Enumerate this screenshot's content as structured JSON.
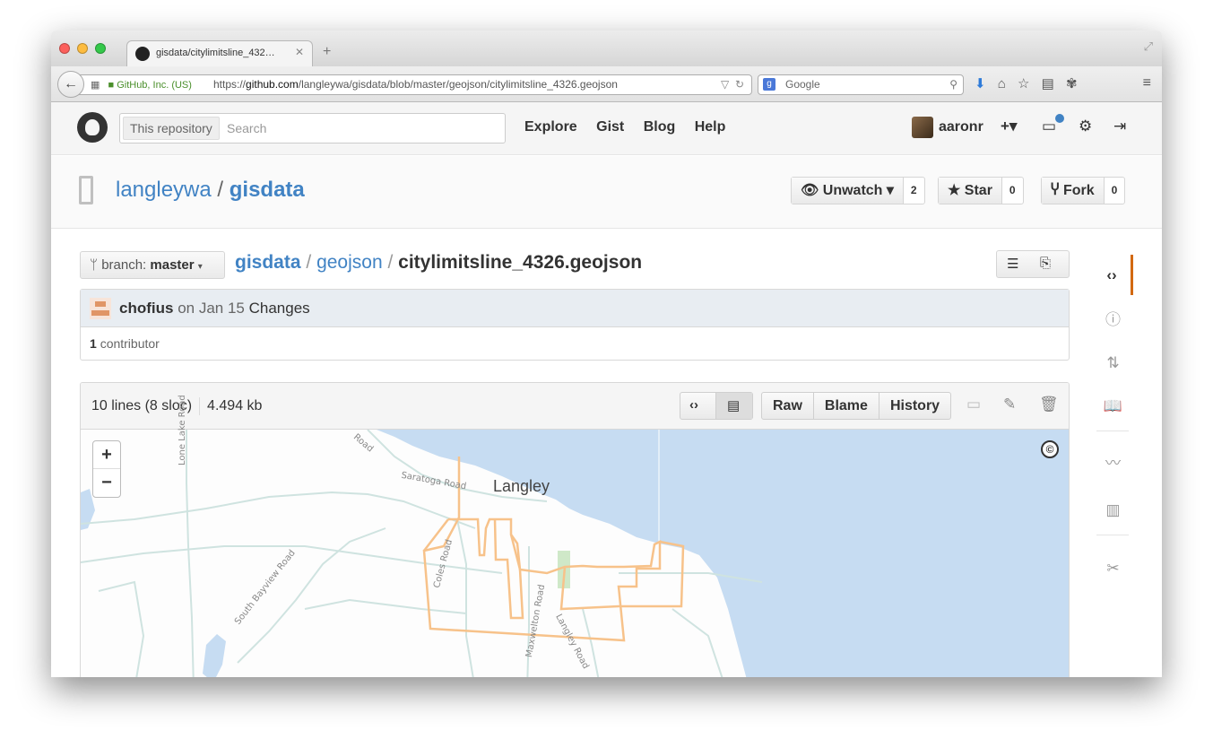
{
  "browser": {
    "tab_title": "gisdata/citylimitsline_432…",
    "tab_close": "✕",
    "new_tab": "+",
    "site_identity": "GitHub, Inc. (US)",
    "url_prefix": "https://",
    "url_domain": "github.com",
    "url_path": "/langleywa/gisdata/blob/master/geojson/citylimitsline_4326.geojson",
    "search_engine_badge": "g",
    "search_placeholder": "Google",
    "icons": [
      "back-arrow-icon",
      "lock-icon",
      "reload-icon",
      "search-icon",
      "download-icon",
      "home-icon",
      "star-icon",
      "reading-list-icon",
      "addon-icon",
      "menu-icon"
    ]
  },
  "github_header": {
    "search_scope": "This repository",
    "search_placeholder": "Search",
    "nav": [
      "Explore",
      "Gist",
      "Blog",
      "Help"
    ],
    "username": "aaronr",
    "plus_label": "+▾"
  },
  "repo": {
    "owner": "langleywa",
    "separator": "/",
    "name": "gisdata",
    "unwatch_label": "Unwatch ▾",
    "watch_count": "2",
    "star_label": "Star",
    "star_count": "0",
    "fork_label": "Fork",
    "fork_count": "0"
  },
  "file_nav": {
    "branch_prefix": "branch:",
    "branch_name": "master",
    "branch_caret": "▾",
    "crumb_repo": "gisdata",
    "crumb_dir": "geojson",
    "crumb_sep": "/",
    "crumb_file": "citylimitsline_4326.geojson"
  },
  "commit": {
    "author": "chofius",
    "date_text": "on Jan 15",
    "message": "Changes",
    "contrib_count": "1",
    "contrib_label": "contributor"
  },
  "file": {
    "lines": "10 lines (8 sloc)",
    "size": "4.494 kb",
    "actions": [
      "Raw",
      "Blame",
      "History"
    ]
  },
  "map": {
    "zoom_in": "+",
    "zoom_out": "−",
    "attribution": "©",
    "town": "Langley",
    "roads": [
      "Lone Lake Road",
      "Saratoga Road",
      "Coles Road",
      "South Bayview Road",
      "Maxwelton Road",
      "Langley Road",
      "Road"
    ],
    "colors": {
      "water": "#c6dcf2",
      "boundary": "#f7c28a",
      "roads": "#cfe3e0"
    }
  },
  "colors": {
    "link": "#4183c4",
    "active_tab_border": "#d26911"
  }
}
